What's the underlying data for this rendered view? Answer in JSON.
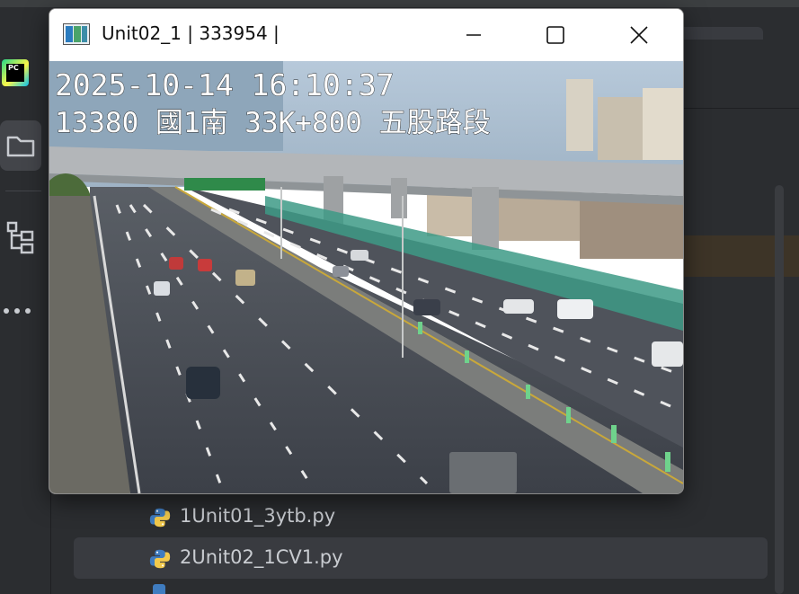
{
  "ide": {
    "app_logo": "PC",
    "toolbar_icons": [
      "folder-icon",
      "structure-icon",
      "more-icon"
    ],
    "files": [
      {
        "name": "1Unit01_3ytb.py",
        "icon": "python-icon",
        "selected": false
      },
      {
        "name": "2Unit02_1CV1.py",
        "icon": "python-icon",
        "selected": true
      }
    ]
  },
  "cv_window": {
    "title": "Unit02_1 | 333954 |",
    "controls": [
      "minimize-icon",
      "maximize-icon",
      "close-icon"
    ],
    "image": {
      "timestamp": "2025-10-14 16:10:37",
      "location": "13380 國1南 33K+800 五股路段",
      "description_colors": {
        "sky": "#9fb8cf",
        "road": "#4a4e57",
        "barrier": "#3d9a86"
      }
    }
  }
}
